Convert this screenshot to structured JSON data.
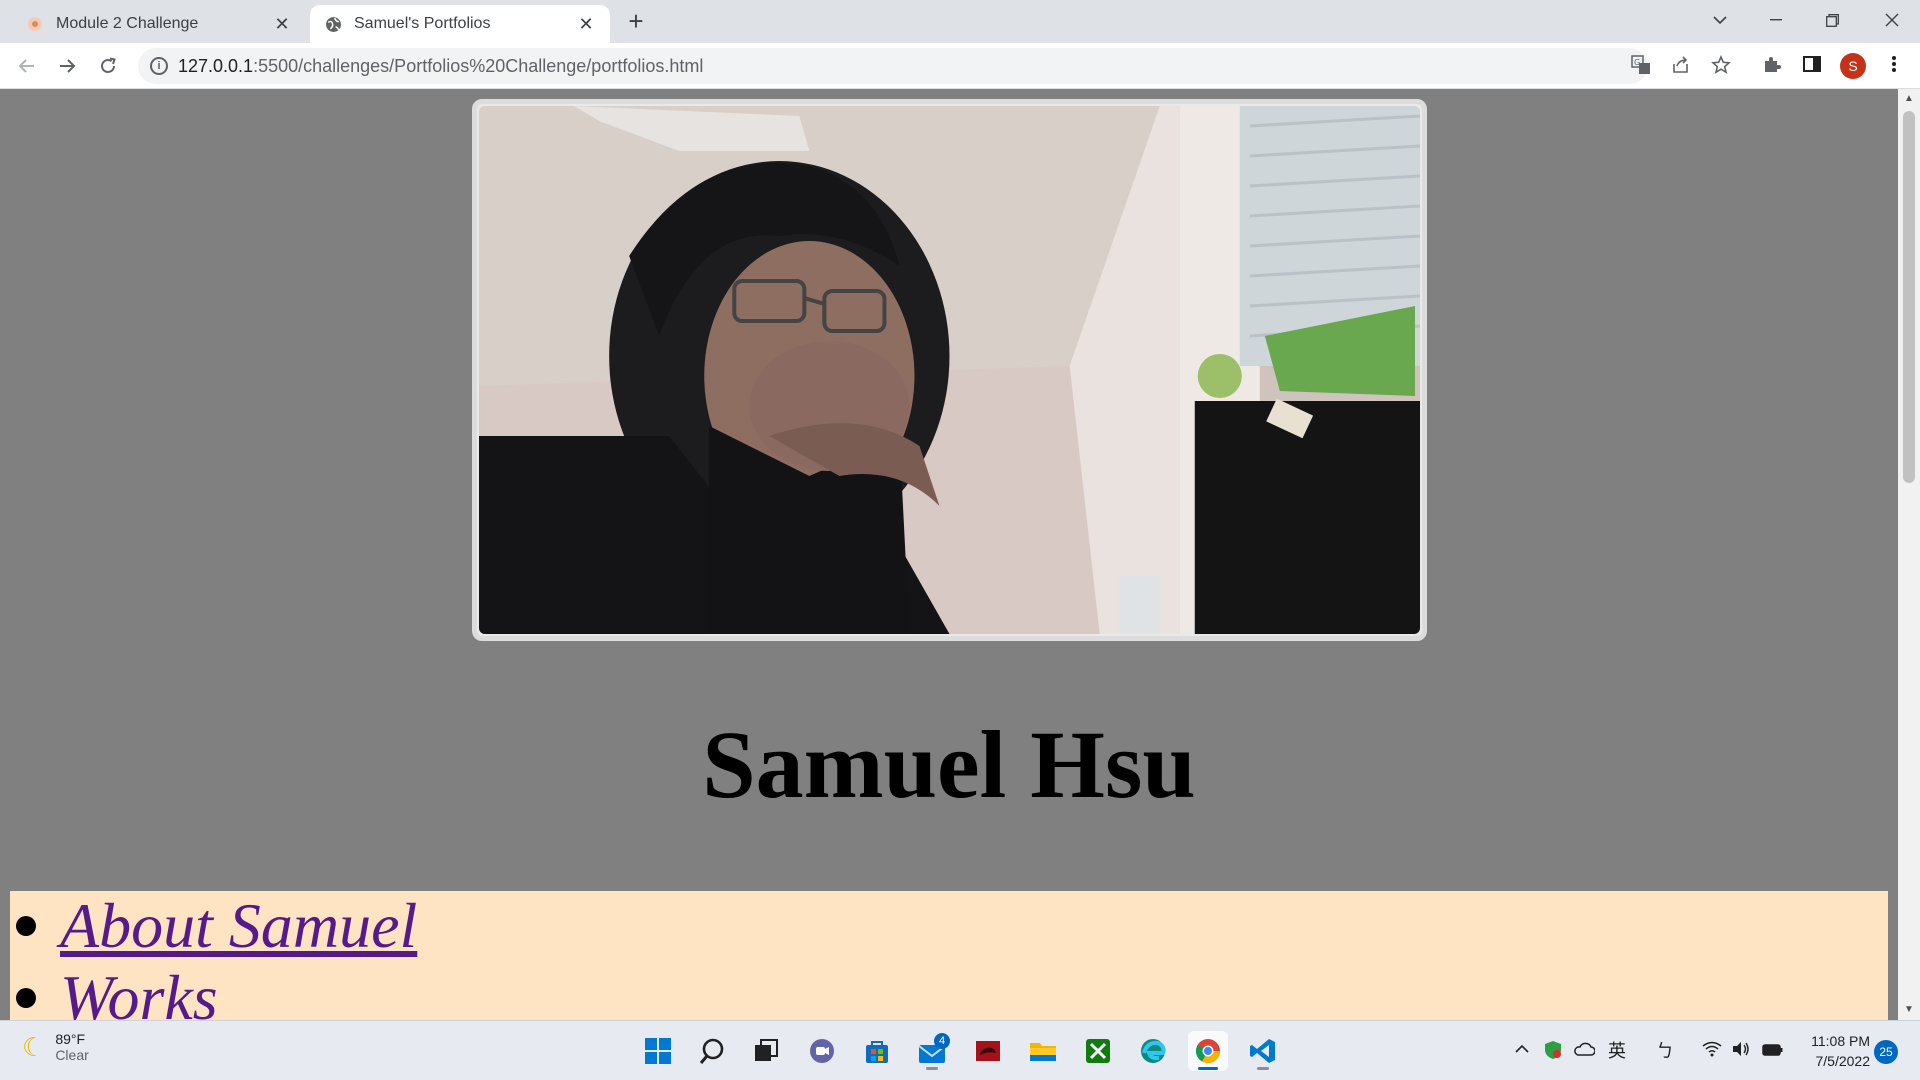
{
  "browser": {
    "tabs": [
      {
        "title": "Module 2 Challenge",
        "icon": "module-favicon"
      },
      {
        "title": "Samuel's Portfolios",
        "icon": "globe-icon"
      }
    ],
    "url_host": "127.0.0.1",
    "url_rest": ":5500/challenges/Portfolios%20Challenge/portfolios.html",
    "profile_initial": "S",
    "profile_color": "#c5321a"
  },
  "page": {
    "name": "Samuel Hsu",
    "nav": [
      {
        "label": "About Samuel"
      },
      {
        "label": "Works"
      }
    ],
    "background": "#808080",
    "nav_background": "#ffe4c4",
    "link_color": "#551a8b"
  },
  "taskbar": {
    "weather": {
      "temp": "89°F",
      "condition": "Clear"
    },
    "mail_badge": "4",
    "ime": "英",
    "ime2": "ㄅ",
    "time": "11:08 PM",
    "date": "7/5/2022",
    "notifications": "25"
  }
}
